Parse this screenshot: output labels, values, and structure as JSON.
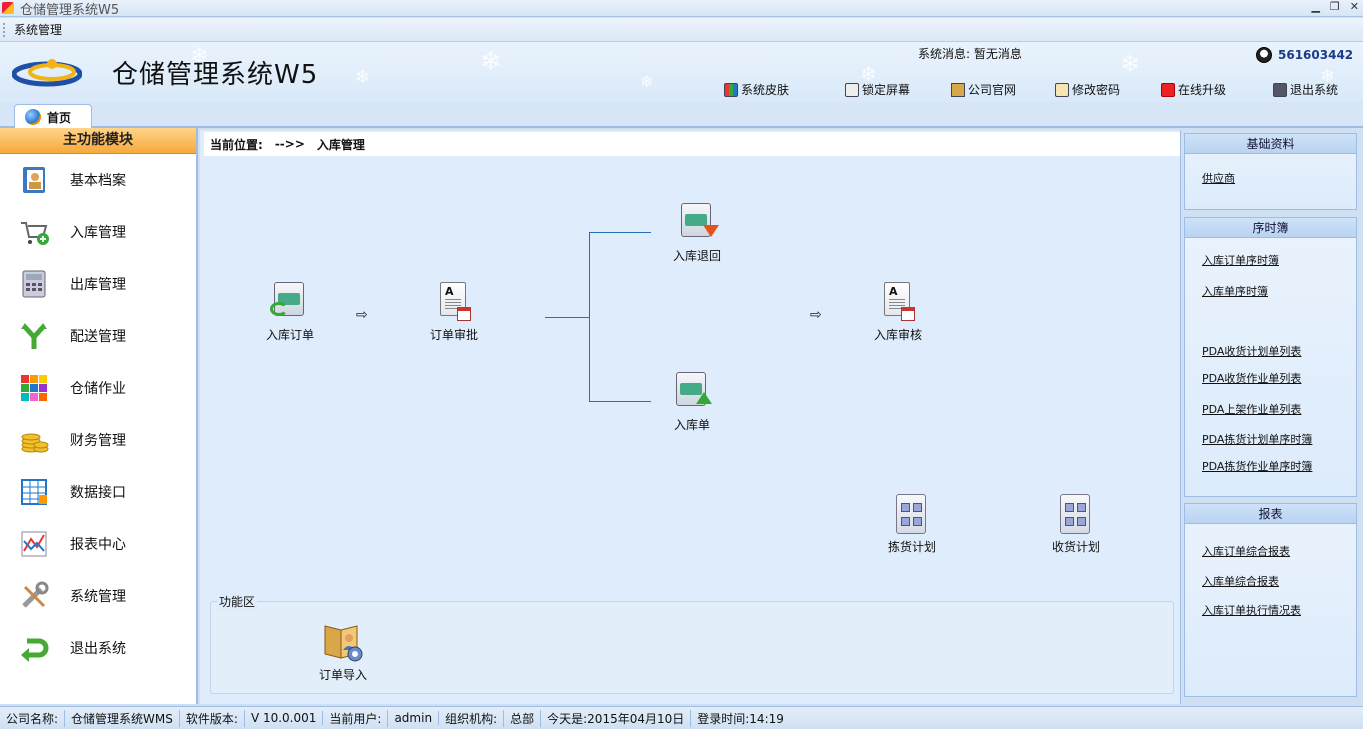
{
  "window": {
    "title": "仓储管理系统W5"
  },
  "menu": {
    "items": [
      "系统管理"
    ]
  },
  "header": {
    "app_title": "仓储管理系统W5",
    "sys_message_label": "系统消息:",
    "sys_message_value": "暂无消息",
    "qq_number": "561603442",
    "toolbar": [
      "系统皮肤",
      "锁定屏幕",
      "公司官网",
      "修改密码",
      "在线升级",
      "退出系统"
    ]
  },
  "tabs": [
    {
      "label": "首页"
    }
  ],
  "sidebar": {
    "title": "主功能模块",
    "items": [
      {
        "label": "基本档案",
        "icon": "address-book-icon"
      },
      {
        "label": "入库管理",
        "icon": "cart-add-icon"
      },
      {
        "label": "出库管理",
        "icon": "calculator-icon"
      },
      {
        "label": "配送管理",
        "icon": "fork-arrow-icon"
      },
      {
        "label": "仓储作业",
        "icon": "color-grid-icon"
      },
      {
        "label": "财务管理",
        "icon": "coins-icon"
      },
      {
        "label": "数据接口",
        "icon": "table-icon"
      },
      {
        "label": "报表中心",
        "icon": "chart-icon"
      },
      {
        "label": "系统管理",
        "icon": "tools-icon"
      },
      {
        "label": "退出系统",
        "icon": "return-arrow-icon"
      }
    ]
  },
  "main": {
    "breadcrumb_label": "当前位置:",
    "breadcrumb_sep": "-->>",
    "breadcrumb_current": "入库管理",
    "flow": {
      "order": "入库订单",
      "approve": "订单审批",
      "return": "入库退回",
      "receipt": "入库单",
      "audit": "入库审核",
      "pick_plan": "拣货计划",
      "receive_plan": "收货计划"
    },
    "func_area": {
      "title": "功能区",
      "items": [
        "订单导入"
      ]
    }
  },
  "right": {
    "basic": {
      "title": "基础资料",
      "links": [
        "供应商"
      ]
    },
    "ledger": {
      "title": "序时簿",
      "links": [
        "入库订单序时簿",
        "入库单序时簿",
        "PDA收货计划单列表",
        "PDA收货作业单列表",
        "PDA上架作业单列表",
        "PDA拣货计划单序时簿",
        "PDA拣货作业单序时簿"
      ]
    },
    "report": {
      "title": "报表",
      "links": [
        "入库订单综合报表",
        "入库单综合报表",
        "入库订单执行情况表"
      ]
    }
  },
  "status": {
    "company_label": "公司名称:",
    "company_value": "仓储管理系统WMS",
    "version_label": "软件版本:",
    "version_value": "V 10.0.001",
    "user_label": "当前用户:",
    "user_value": "admin",
    "org_label": "组织机构:",
    "org_value": "总部",
    "today": "今天是:2015年04月10日",
    "login_time": "登录时间:14:19"
  },
  "colors": {
    "accent": "#f7a93b",
    "border": "#9fbde2",
    "line": "#2a6db0"
  }
}
